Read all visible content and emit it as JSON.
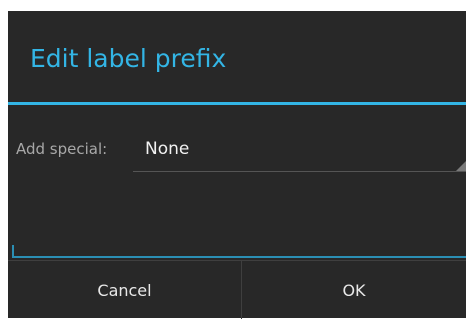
{
  "dialog": {
    "title": "Edit label prefix",
    "add_special_label": "Add special:",
    "add_special_value": "None",
    "cancel_label": "Cancel",
    "ok_label": "OK"
  },
  "colors": {
    "accent": "#33b5e5",
    "background": "#282828",
    "text_primary": "#f2f2f2",
    "text_secondary": "#a8a8a8"
  },
  "icons": {
    "spinner_indicator": "dropdown-triangle-icon"
  }
}
